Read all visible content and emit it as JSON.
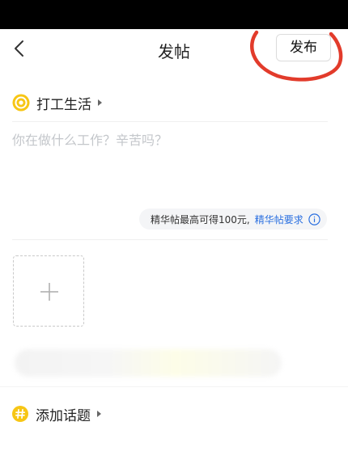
{
  "header": {
    "title": "发帖",
    "publish_label": "发布"
  },
  "category": {
    "label": "打工生活"
  },
  "composer": {
    "placeholder": "你在做什么工作？辛苦吗？",
    "value": ""
  },
  "essence_tip": {
    "text": "精华帖最高可得100元,",
    "link": "精华帖要求"
  },
  "topic": {
    "label": "添加话题"
  },
  "colors": {
    "accent_yellow": "#f7c615",
    "link_blue": "#2a6fe0",
    "annotation_red": "#e23b2b"
  },
  "icons": [
    "back-arrow-icon",
    "spiral-icon",
    "info-icon",
    "plus-icon",
    "hashtag-icon"
  ]
}
